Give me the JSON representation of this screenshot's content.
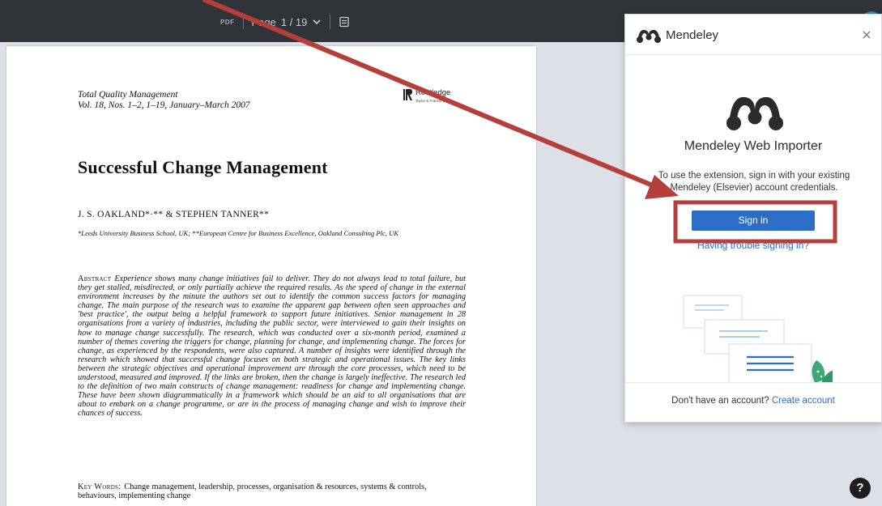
{
  "toolbar": {
    "file_type": "PDF",
    "page_label": "Page",
    "page_value": "1 / 19",
    "icons": {
      "chevron": "chevron-down-icon",
      "view": "document-view-icon",
      "avatar": "user-avatar"
    }
  },
  "pdf": {
    "journal_line1": "Total Quality Management",
    "journal_line2": "Vol. 18, Nos. 1–2, 1–19, January–March 2007",
    "publisher_name": "Routledge",
    "publisher_sub": "Taylor & Francis Group",
    "title": "Successful Change Management",
    "authors": "J. S. OAKLAND*·** & STEPHEN TANNER**",
    "affiliation": "*Leeds University Business School, UK; **European Centre for Business Excellence, Oakland Consulting Plc, UK",
    "abstract_label": "Abstract",
    "abstract_body": "Experience shows many change initiatives fail to deliver. They do not always lead to total failure, but they get stalled, misdirected, or only partially achieve the required results. As the speed of change in the external environment increases by the minute the authors set out to identify the common success factors for managing change. The main purpose of the research was to examine the apparent gap between often seen approaches and 'best practice', the output being a helpful framework to support future initiatives. Senior management in 28 organisations from a variety of industries, including the public sector, were interviewed to gain their insights on how to manage change successfully. The research, which was conducted over a six-month period, examined a number of themes covering the triggers for change, planning for change, and implementing change. The forces for change, as experienced by the respondents, were also captured. A number of insights were identified through the research which showed that successful change focuses on both strategic and operational issues. The key links between the strategic objectives and operational improvement are through the core processes, which need to be understood, measured and improved. If the links are broken, then the change is largely ineffective. The research led to the definition of two main constructs of change management: readiness for change and implementing change. These have been shown diagrammatically in a framework which should be an aid to all organisations that are about to embark on a change programme, or are in the process of managing change and wish to improve their chances of success.",
    "keywords_label": "Key Words:",
    "keywords_body": "Change management, leadership, processes, organisation & resources, systems & controls, behaviours, implementing change"
  },
  "mendeley": {
    "header_name": "Mendeley",
    "title": "Mendeley Web Importer",
    "description": "To use the extension, sign in with your existing Mendeley (Elsevier) account credentials.",
    "signin_label": "Sign in",
    "trouble_link": "Having trouble signing in?",
    "footer_text": "Don't have an account?",
    "create_link": "Create account",
    "brand_color": "#2c6ec6",
    "icons": {
      "logo": "mendeley-logo-icon",
      "close": "close-icon"
    }
  },
  "annotation": {
    "color": "#b5403b",
    "arrow": "annotation-arrow",
    "highlight": "signin-highlight-box"
  },
  "help": {
    "label": "?"
  }
}
